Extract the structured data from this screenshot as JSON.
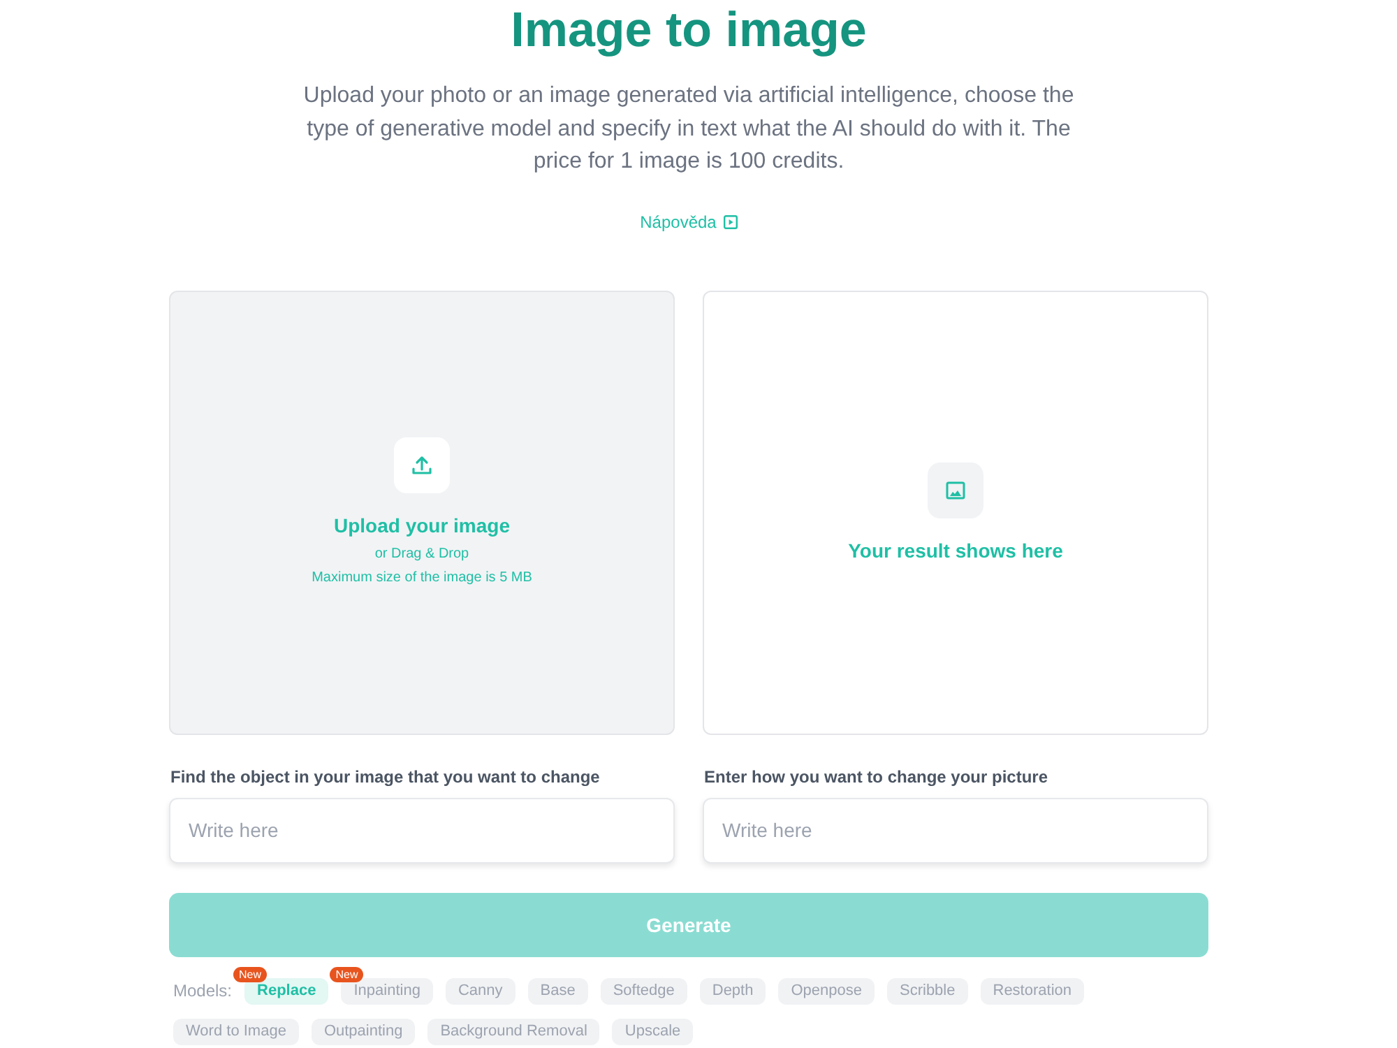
{
  "header": {
    "title": "Image to image",
    "description": "Upload your photo or an image generated via artificial intelligence, choose the type of generative model and specify in text what the AI should do with it. The price for 1 image is 100 credits.",
    "help_link": "Nápověda"
  },
  "upload_panel": {
    "title": "Upload your image",
    "hint": "or Drag & Drop",
    "limit": "Maximum size of the image is 5 MB"
  },
  "result_panel": {
    "text": "Your result shows here"
  },
  "fields": [
    {
      "label": "Find the object in your image that you want to change",
      "placeholder": "Write here"
    },
    {
      "label": "Enter how you want to change your picture",
      "placeholder": "Write here"
    }
  ],
  "generate_button": {
    "label": "Generate",
    "disabled": true
  },
  "models": {
    "label": "Models:",
    "items": [
      {
        "label": "Replace",
        "selected": true,
        "badge": "New"
      },
      {
        "label": "Inpainting",
        "selected": false,
        "badge": "New"
      },
      {
        "label": "Canny",
        "selected": false
      },
      {
        "label": "Base",
        "selected": false
      },
      {
        "label": "Softedge",
        "selected": false
      },
      {
        "label": "Depth",
        "selected": false
      },
      {
        "label": "Openpose",
        "selected": false
      },
      {
        "label": "Scribble",
        "selected": false
      },
      {
        "label": "Restoration",
        "selected": false
      },
      {
        "label": "Word to Image",
        "selected": false
      },
      {
        "label": "Outpainting",
        "selected": false
      },
      {
        "label": "Background Removal",
        "selected": false
      },
      {
        "label": "Upscale",
        "selected": false
      }
    ]
  }
}
